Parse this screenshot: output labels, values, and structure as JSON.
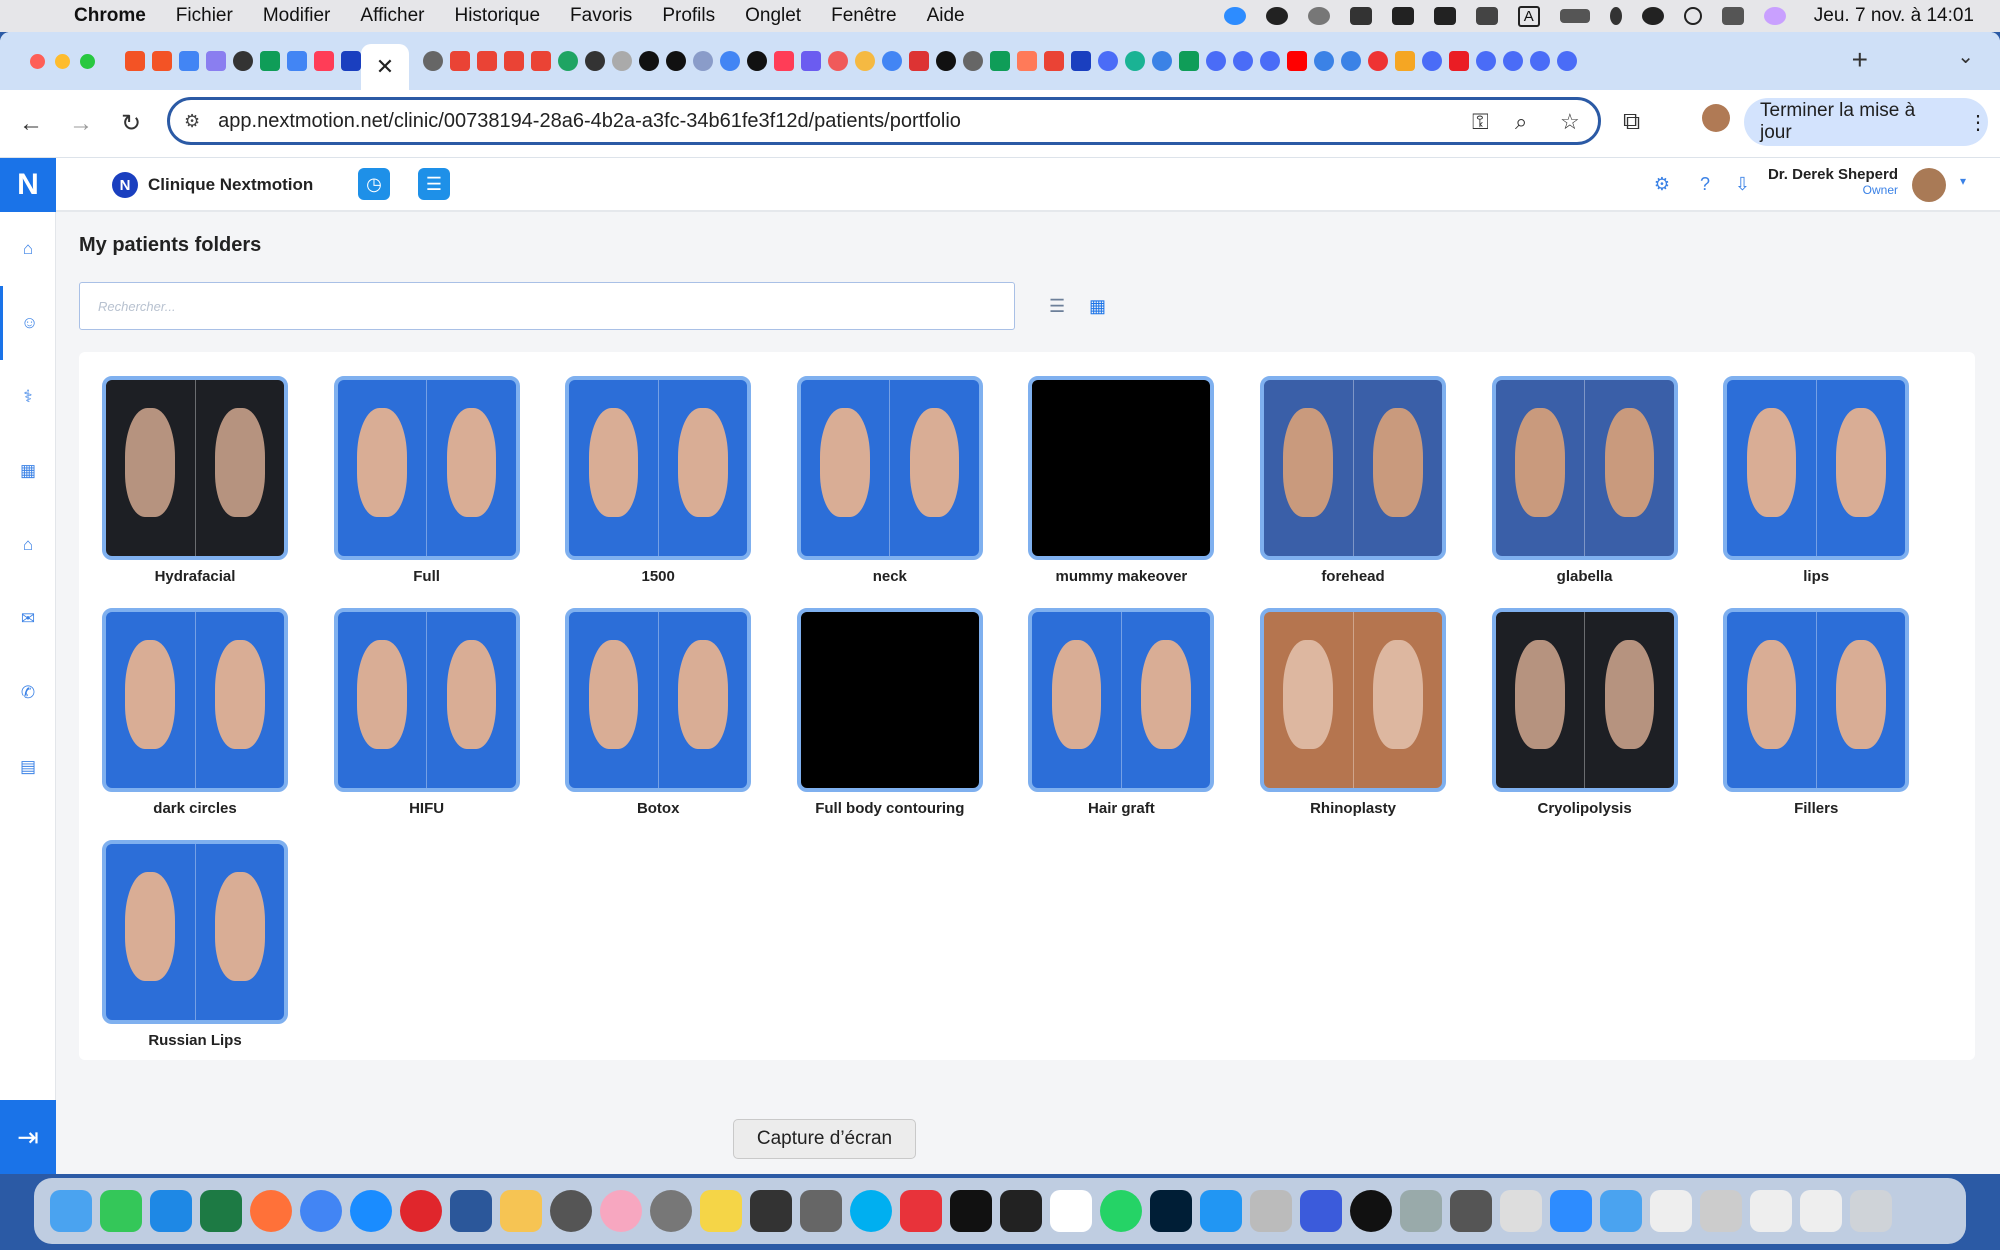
{
  "menubar": {
    "app_name": "Chrome",
    "items": [
      "Fichier",
      "Modifier",
      "Afficher",
      "Historique",
      "Favoris",
      "Profils",
      "Onglet",
      "Fenêtre",
      "Aide"
    ],
    "clock": "Jeu. 7 nov. à 14:01",
    "keyboard_badge": "A"
  },
  "browser": {
    "url": "app.nextmotion.net/clinic/00738194-28a6-4b2a-a3fc-34b61fe3f12d/patients/portfolio",
    "active_tab_close": "✕",
    "update_button": "Terminer la mise à jour"
  },
  "app": {
    "logo_letter": "N",
    "clinic_name": "Clinique Nextmotion",
    "user_name": "Dr. Derek Sheperd",
    "user_role": "Owner",
    "page_title": "My patients folders",
    "search_placeholder": "Rechercher...",
    "folders": [
      {
        "label": "Hydrafacial",
        "style": "studio"
      },
      {
        "label": "Full",
        "style": "blue"
      },
      {
        "label": "1500",
        "style": "blue"
      },
      {
        "label": "neck",
        "style": "blue"
      },
      {
        "label": "mummy makeover",
        "style": "black"
      },
      {
        "label": "forehead",
        "style": "warm"
      },
      {
        "label": "glabella",
        "style": "warm"
      },
      {
        "label": "lips",
        "style": "blue"
      },
      {
        "label": "dark circles",
        "style": "blue"
      },
      {
        "label": "HIFU",
        "style": "blue"
      },
      {
        "label": "Botox",
        "style": "blue"
      },
      {
        "label": "Full body contouring",
        "style": "black"
      },
      {
        "label": "Hair graft",
        "style": "blue"
      },
      {
        "label": "Rhinoplasty",
        "style": "wood"
      },
      {
        "label": "Cryolipolysis",
        "style": "studio"
      },
      {
        "label": "Fillers",
        "style": "blue"
      },
      {
        "label": "Russian Lips",
        "style": "blue"
      }
    ]
  },
  "tooltip": "Capture d’écran",
  "colors": {
    "accent": "#1a73e8",
    "thumb_border": "#7fb0ef",
    "omnibox_border": "#2b5aa5"
  }
}
